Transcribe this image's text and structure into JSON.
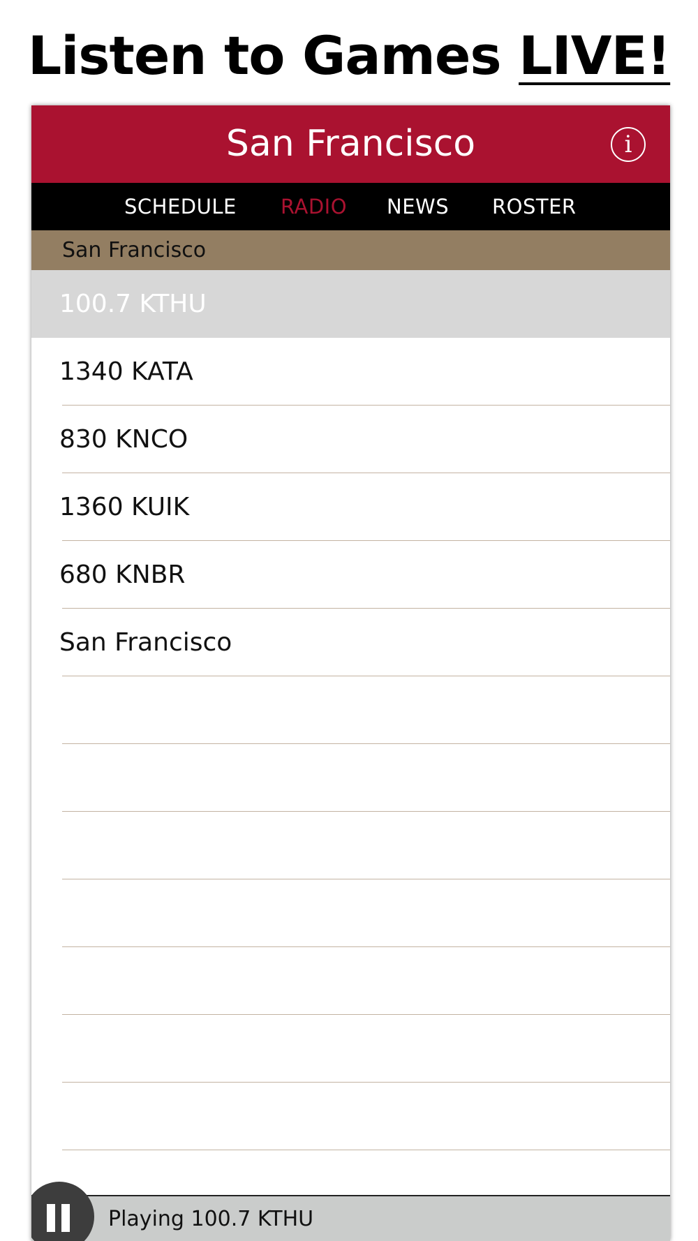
{
  "headline": {
    "prefix": "Listen to Games ",
    "emphasis": "LIVE!"
  },
  "header": {
    "title": "San Francisco",
    "info_icon": "info-icon",
    "info_glyph": "i"
  },
  "tabs": [
    {
      "label": "SCHEDULE",
      "active": false
    },
    {
      "label": "RADIO",
      "active": true
    },
    {
      "label": "NEWS",
      "active": false
    },
    {
      "label": "ROSTER",
      "active": false
    }
  ],
  "section": {
    "label": "San Francisco"
  },
  "stations": [
    {
      "label": "100.7 KTHU",
      "selected": true
    },
    {
      "label": "1340 KATA",
      "selected": false
    },
    {
      "label": "830 KNCO",
      "selected": false
    },
    {
      "label": "1360 KUIK",
      "selected": false
    },
    {
      "label": "680 KNBR",
      "selected": false
    },
    {
      "label": "San Francisco",
      "selected": false
    },
    {
      "label": "",
      "selected": false
    },
    {
      "label": "",
      "selected": false
    },
    {
      "label": "",
      "selected": false
    },
    {
      "label": "",
      "selected": false
    },
    {
      "label": "",
      "selected": false
    },
    {
      "label": "",
      "selected": false
    },
    {
      "label": "",
      "selected": false
    }
  ],
  "player": {
    "status": "Playing 100.7 KTHU",
    "control_icon": "pause-icon"
  },
  "colors": {
    "brand_red": "#aa1230",
    "gold": "#937e62",
    "tab_bar": "#000000",
    "selected_row": "#d7d7d7",
    "player_bar": "#cacccb"
  }
}
